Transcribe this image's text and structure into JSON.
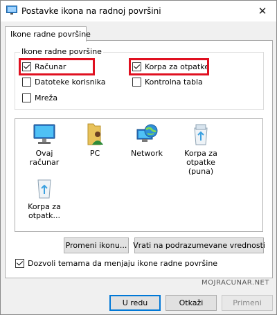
{
  "window": {
    "title": "Postavke ikona na radnoj površini",
    "icon": "desktop-settings-icon",
    "close_glyph": "✕"
  },
  "tabs": [
    {
      "label": "Ikone radne površine",
      "selected": true
    }
  ],
  "desktop_icons_group": {
    "legend": "Ikone radne površine",
    "checkboxes": [
      {
        "label": "Računar",
        "checked": true,
        "highlighted": true
      },
      {
        "label": "Korpa za otpatke",
        "checked": true,
        "highlighted": true
      },
      {
        "label": "Datoteke korisnika",
        "checked": false
      },
      {
        "label": "Kontrolna tabla",
        "checked": false
      },
      {
        "label": "Mreža",
        "checked": false
      }
    ]
  },
  "icon_list": {
    "items": [
      {
        "label": "Ovaj računar",
        "icon": "computer-icon"
      },
      {
        "label": "PC",
        "icon": "user-folder-icon"
      },
      {
        "label": "Network",
        "icon": "network-globe-icon"
      },
      {
        "label": "Korpa za otpatke (puna)",
        "icon": "recycle-bin-full-icon"
      },
      {
        "label": "Korpa za otpatk...",
        "icon": "recycle-bin-empty-icon"
      }
    ]
  },
  "buttons": {
    "change_icon": "Promeni ikonu...",
    "restore_default": "Vrati na podrazumevane vrednosti",
    "ok": "U redu",
    "cancel": "Otkaži",
    "apply": "Primeni"
  },
  "themes_checkbox": {
    "label": "Dozvoli temama da menjaju ikone radne površine",
    "checked": true
  },
  "watermark": "MOJRACUNAR.NET",
  "colors": {
    "highlight": "#e01020",
    "accent": "#0078d7"
  }
}
